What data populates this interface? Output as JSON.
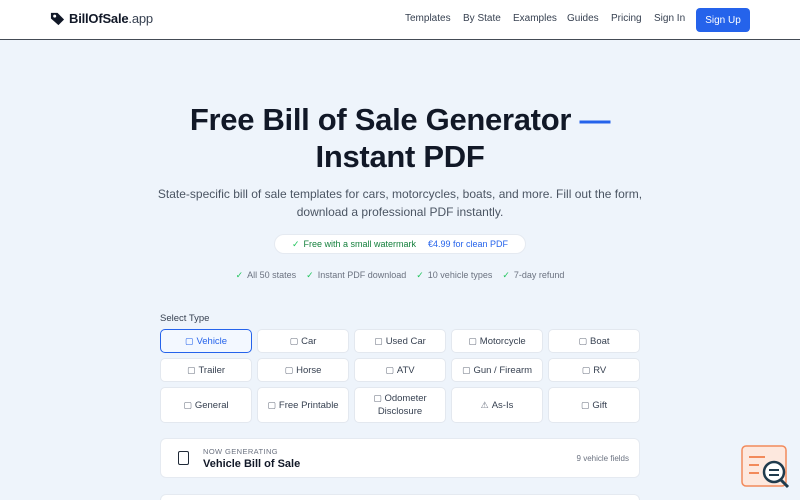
{
  "header": {
    "logo_name": "BillOfSale",
    "logo_tld": ".app",
    "nav": [
      "Templates",
      "By State",
      "Examples",
      "Guides",
      "Pricing",
      "Sign In"
    ],
    "signup_label": "Sign Up"
  },
  "hero": {
    "title_main": "Free Bill of Sale Generator",
    "title_dash": "—",
    "title_accent": "Instant PDF",
    "subtitle_line1": "State-specific bill of sale templates for cars, motorcycles, boats, and more. Fill out the form,",
    "subtitle_line2": "download a professional PDF instantly.",
    "pill_free": "Free with a small watermark",
    "pill_paid": "€4.99 for clean PDF",
    "features": [
      "All 50 states",
      "Instant PDF download",
      "10 vehicle types",
      "7-day refund"
    ]
  },
  "select": {
    "label": "Select Type",
    "types": [
      {
        "label": "Vehicle",
        "icon": "car-icon"
      },
      {
        "label": "Car",
        "icon": "car-icon"
      },
      {
        "label": "Used Car",
        "icon": "car-icon"
      },
      {
        "label": "Motorcycle",
        "icon": "motorcycle-icon"
      },
      {
        "label": "Boat",
        "icon": "boat-icon"
      },
      {
        "label": "Trailer",
        "icon": "trailer-icon"
      },
      {
        "label": "Horse",
        "icon": "horse-icon"
      },
      {
        "label": "ATV",
        "icon": "atv-icon"
      },
      {
        "label": "Gun / Firearm",
        "icon": "gun-icon"
      },
      {
        "label": "RV",
        "icon": "rv-icon"
      },
      {
        "label": "General",
        "icon": "document-icon"
      },
      {
        "label": "Free Printable",
        "icon": "printer-icon"
      },
      {
        "label": "Odometer Disclosure",
        "icon": "gauge-icon"
      },
      {
        "label": "As-Is",
        "icon": "warning-icon"
      },
      {
        "label": "Gift",
        "icon": "gift-icon"
      }
    ],
    "selected": "Vehicle"
  },
  "generating": {
    "overline": "NOW GENERATING",
    "title": "Vehicle Bill of Sale",
    "fields": "9 vehicle fields"
  },
  "colors": {
    "accent": "#2563eb",
    "background": "#eef4fb",
    "success": "#15803d"
  }
}
